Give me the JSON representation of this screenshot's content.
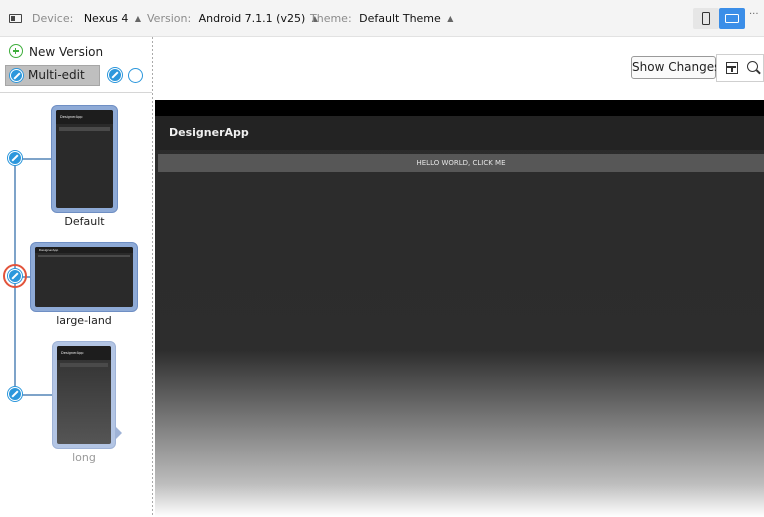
{
  "toolbar": {
    "device_label": "Device:",
    "device_value": "Nexus 4",
    "version_label": "Version:",
    "version_value": "Android 7.1.1 (v25)",
    "theme_label": "Theme:",
    "theme_value": "Default Theme",
    "more": "···"
  },
  "versions": {
    "new_version_label": "New Version",
    "multi_edit_label": "Multi-edit",
    "items": [
      {
        "caption": "Default",
        "app_title": "DesignerApp",
        "button_text": "HELLO WORLD, CLICK ME"
      },
      {
        "caption": "large-land",
        "app_title": "DesignerApp",
        "button_text": "HELLO WORLD, CLICK ME"
      },
      {
        "caption": "long",
        "app_title": "DesignerApp",
        "button_text": "HELLO WORLD, CLICK ME"
      }
    ]
  },
  "canvas": {
    "show_changes_label": "Show Changes",
    "app_title": "DesignerApp",
    "button_text": "HELLO WORLD, CLICK ME"
  },
  "colors": {
    "accent": "#3b8ee8",
    "pencil": "#2c97dc",
    "thumb_border": "#8eaad6",
    "selection": "#e2533b"
  }
}
